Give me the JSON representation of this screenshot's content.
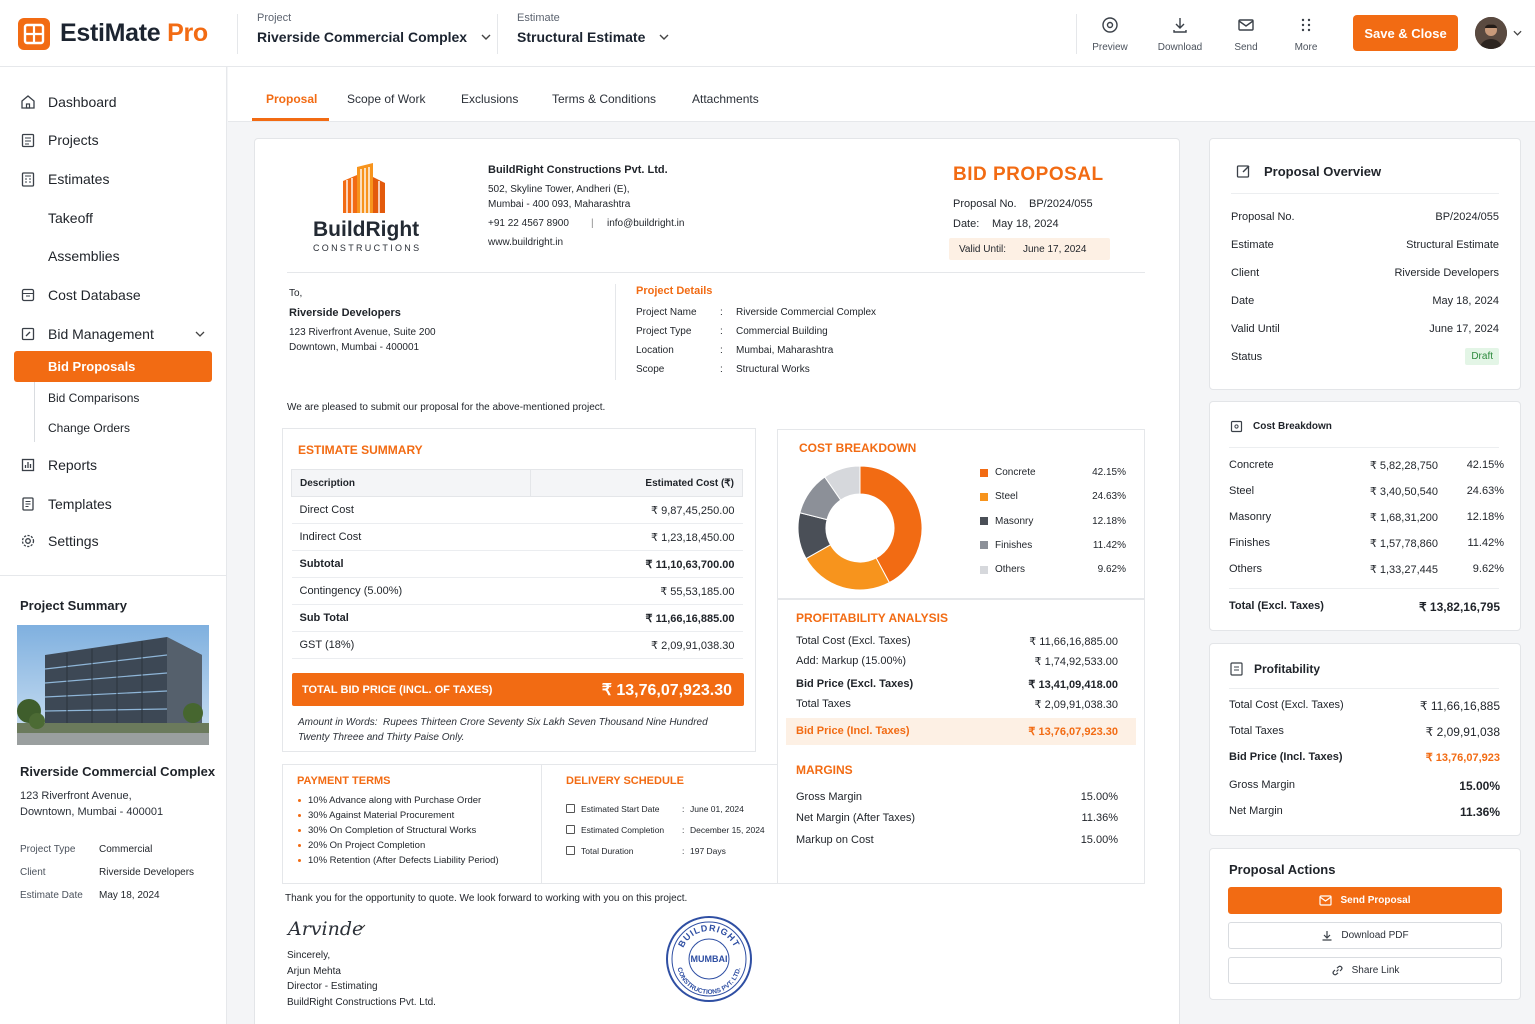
{
  "header": {
    "app_name": "EstiMate",
    "app_name_suffix": "Pro",
    "project_label": "Project",
    "project_value": "Riverside Commercial Complex",
    "estimate_label": "Estimate",
    "estimate_value": "Structural Estimate",
    "tools": [
      "Preview",
      "Download",
      "Send",
      "More"
    ],
    "save_label": "Save & Close"
  },
  "sidebar": {
    "items": [
      "Dashboard",
      "Projects",
      "Estimates",
      "Takeoff",
      "Assemblies",
      "Cost Database",
      "Bid Management",
      "Bid Proposals",
      "Bid Comparisons",
      "Change Orders",
      "Reports",
      "Templates",
      "Settings"
    ],
    "project_summary": {
      "title": "Project Summary",
      "name": "Riverside Commercial Complex",
      "address1": "123 Riverfront Avenue,",
      "address2": "Downtown, Mumbai - 400001",
      "fields": [
        {
          "label": "Project Type",
          "value": "Commercial"
        },
        {
          "label": "Client",
          "value": "Riverside Developers"
        },
        {
          "label": "Estimate Date",
          "value": "May 18, 2024"
        }
      ]
    }
  },
  "tabs": [
    "Proposal",
    "Scope of Work",
    "Exclusions",
    "Terms & Conditions",
    "Attachments"
  ],
  "doc": {
    "company_logo_name": "BuildRight",
    "company_logo_sub": "CONSTRUCTIONS",
    "company_name": "BuildRight Constructions Pvt. Ltd.",
    "address1": "502, Skyline Tower, Andheri (E),",
    "address2": "Mumbai - 400 093, Maharashtra",
    "phone": "+91 22 4567 8900",
    "email": "info@buildright.in",
    "website": "www.buildright.in",
    "title": "BID PROPOSAL",
    "proposal_no_label": "Proposal No.",
    "proposal_no": "BP/2024/055",
    "date_label": "Date:",
    "date": "May 18, 2024",
    "valid_label": "Valid Until:",
    "valid_until": "June 17, 2024",
    "to_label": "To,",
    "client_name": "Riverside Developers",
    "client_addr1": "123 Riverfront Avenue, Suite 200",
    "client_addr2": "Downtown, Mumbai - 400001",
    "project_details_title": "Project Details",
    "project_details": [
      {
        "label": "Project Name",
        "value": "Riverside Commercial Complex"
      },
      {
        "label": "Project Type",
        "value": "Commercial Building"
      },
      {
        "label": "Location",
        "value": "Mumbai, Maharashtra"
      },
      {
        "label": "Scope",
        "value": "Structural Works"
      }
    ],
    "intro": "We are pleased to submit our proposal for the above-mentioned project.",
    "estimate_summary": {
      "title": "ESTIMATE SUMMARY",
      "col_desc": "Description",
      "col_cost": "Estimated Cost (₹)",
      "rows": [
        {
          "d": "Direct Cost",
          "v": "₹ 9,87,45,250.00"
        },
        {
          "d": "Indirect Cost",
          "v": "₹ 1,23,18,450.00"
        },
        {
          "d": "Subtotal",
          "v": "₹ 11,10,63,700.00"
        },
        {
          "d": "Contingency (5.00%)",
          "v": "₹ 55,53,185.00"
        },
        {
          "d": "Sub Total",
          "v": "₹ 11,66,16,885.00"
        },
        {
          "d": "GST (18%)",
          "v": "₹ 2,09,91,038.30"
        }
      ],
      "total_label": "TOTAL BID PRICE (INCL. OF TAXES)",
      "total_value": "₹ 13,76,07,923.30",
      "words_label": "Amount in Words:",
      "words": "Rupees Thirteen Crore Seventy Six Lakh Seven Thousand Nine Hundred Twenty Threee and Thirty Paise Only."
    },
    "payment_terms": {
      "title": "PAYMENT TERMS",
      "items": [
        "10% Advance along with Purchase Order",
        "30% Against Material Procurement",
        "30% On Completion of Structural Works",
        "20% On Project Completion",
        "10% Retention (After Defects Liability Period)"
      ]
    },
    "delivery": {
      "title": "DELIVERY SCHEDULE",
      "rows": [
        {
          "label": "Estimated Start Date",
          "value": "June 01, 2024"
        },
        {
          "label": "Estimated Completion",
          "value": "December 15, 2024"
        },
        {
          "label": "Total Duration",
          "value": "197 Days"
        }
      ]
    },
    "profitability": {
      "title": "PROFITABILITY ANALYSIS",
      "rows": [
        {
          "l": "Total Cost (Excl. Taxes)",
          "v": "₹ 11,66,16,885.00"
        },
        {
          "l": "Add: Markup (15.00%)",
          "v": "₹ 1,74,92,533.00"
        },
        {
          "l": "Bid Price (Excl. Taxes)",
          "v": "₹ 13,41,09,418.00"
        },
        {
          "l": "Total Taxes",
          "v": "₹ 2,09,91,038.30"
        }
      ],
      "bid_label": "Bid Price (Incl. Taxes)",
      "bid_value": "₹ 13,76,07,923.30"
    },
    "margins": {
      "title": "MARGINS",
      "rows": [
        {
          "l": "Gross Margin",
          "v": "15.00%"
        },
        {
          "l": "Net Margin (After Taxes)",
          "v": "11.36%"
        },
        {
          "l": "Markup on Cost",
          "v": "15.00%"
        }
      ]
    },
    "closing": "Thank you for the opportunity to quote. We look forward to working with you on this project.",
    "signature_name": "Arvinde",
    "sign_lines": [
      "Sincerely,",
      "Arjun Mehta",
      "Director - Estimating",
      "BuildRight Constructions Pvt. Ltd."
    ],
    "stamp_top": "BUILDRIGHT",
    "stamp_center": "MUMBAI",
    "stamp_bottom": "CONSTRUCTIONS PVT. LTD."
  },
  "chart_data": {
    "type": "pie",
    "title": "COST BREAKDOWN",
    "categories": [
      "Concrete",
      "Steel",
      "Masonry",
      "Finishes",
      "Others"
    ],
    "values": [
      42.15,
      24.63,
      12.18,
      11.42,
      9.62
    ],
    "labels": [
      "42.15%",
      "24.63%",
      "12.18%",
      "11.42%",
      "9.62%"
    ],
    "colors": [
      "#f26b13",
      "#f7941d",
      "#4a4f57",
      "#8c9098",
      "#d6d8dc"
    ],
    "legend": "right"
  },
  "overview": {
    "title": "Proposal Overview",
    "rows": [
      {
        "l": "Proposal No.",
        "v": "BP/2024/055"
      },
      {
        "l": "Estimate",
        "v": "Structural Estimate"
      },
      {
        "l": "Client",
        "v": "Riverside Developers"
      },
      {
        "l": "Date",
        "v": "May 18, 2024"
      },
      {
        "l": "Valid Until",
        "v": "June 17, 2024"
      }
    ],
    "status_label": "Status",
    "status": "Draft"
  },
  "cost_breakdown": {
    "title": "Cost Breakdown",
    "rows": [
      {
        "l": "Concrete",
        "a": "₹ 5,82,28,750",
        "p": "42.15%"
      },
      {
        "l": "Steel",
        "a": "₹ 3,40,50,540",
        "p": "24.63%"
      },
      {
        "l": "Masonry",
        "a": "₹ 1,68,31,200",
        "p": "12.18%"
      },
      {
        "l": "Finishes",
        "a": "₹ 1,57,78,860",
        "p": "11.42%"
      },
      {
        "l": "Others",
        "a": "₹ 1,33,27,445",
        "p": "9.62%"
      }
    ],
    "total_label": "Total (Excl. Taxes)",
    "total": "₹ 13,82,16,795"
  },
  "profit_panel": {
    "title": "Profitability",
    "rows": [
      {
        "l": "Total Cost (Excl. Taxes)",
        "v": "₹ 11,66,16,885"
      },
      {
        "l": "Total Taxes",
        "v": "₹ 2,09,91,038"
      },
      {
        "l": "Bid Price (Incl. Taxes)",
        "v": "₹ 13,76,07,923"
      },
      {
        "l": "Gross Margin",
        "v": "15.00%"
      },
      {
        "l": "Net Margin",
        "v": "11.36%"
      }
    ]
  },
  "actions": {
    "title": "Proposal Actions",
    "send": "Send Proposal",
    "download": "Download PDF",
    "share": "Share Link"
  }
}
